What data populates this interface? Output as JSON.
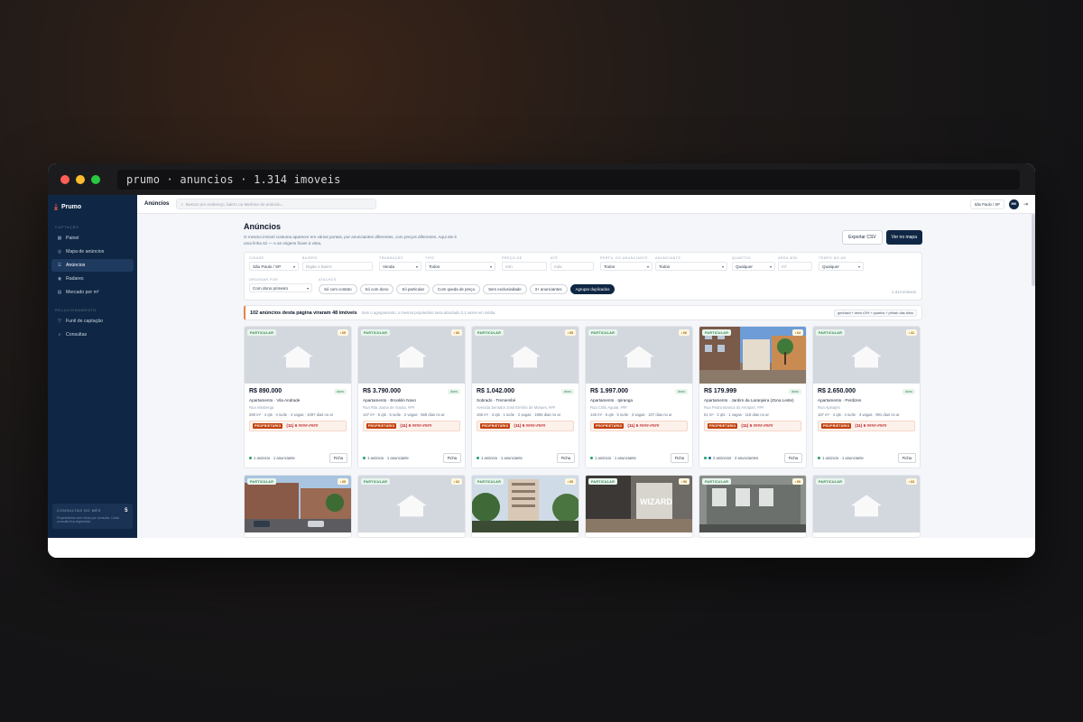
{
  "window": {
    "title": "prumo · anuncios · 1.314 imoveis"
  },
  "sidebar": {
    "brand": "Prumo",
    "sections": [
      {
        "label": "CAPTAÇÃO",
        "items": [
          {
            "label": "Painel",
            "icon": "grid-icon"
          },
          {
            "label": "Mapa de anúncios",
            "icon": "map-pin-icon"
          },
          {
            "label": "Anúncios",
            "icon": "list-icon",
            "active": true
          },
          {
            "label": "Radares",
            "icon": "radar-icon"
          },
          {
            "label": "Mercado por m²",
            "icon": "chart-icon"
          }
        ]
      },
      {
        "label": "RELACIONAMENTO",
        "items": [
          {
            "label": "Funil de captação",
            "icon": "funnel-icon"
          },
          {
            "label": "Consultas",
            "icon": "search-icon"
          }
        ]
      }
    ],
    "consultas": {
      "label": "CONSULTAS DO MÊS",
      "value": "5",
      "sub": "Proprietários com início por consulta. Cada consulta fica registrada."
    }
  },
  "topbar": {
    "title": "Anúncios",
    "search_placeholder": "Buscar por endereço, bairro ou telefone do anúncio...",
    "city": "São Paulo / SP",
    "avatar": "MK"
  },
  "page": {
    "title": "Anúncios",
    "description": "O mesmo imóvel costuma aparecer em vários portais, por anunciantes diferentes, com preços diferentes. Aqui ele é uma linha só — e as origens ficam à vista.",
    "export_label": "Exportar CSV",
    "map_label": "Ver no mapa"
  },
  "filters": {
    "cidade": {
      "label": "CIDADE",
      "value": "São Paulo / SP"
    },
    "bairro": {
      "label": "BAIRRO",
      "placeholder": "Digite o bairro"
    },
    "transacao": {
      "label": "TRANSAÇÃO",
      "value": "Venda"
    },
    "tipo": {
      "label": "TIPO",
      "value": "Todos"
    },
    "preco_de": {
      "label": "PREÇO DE",
      "placeholder": "mín"
    },
    "ate": {
      "label": "ATÉ",
      "placeholder": "máx"
    },
    "perfil": {
      "label": "PERFIL DO ANUNCIANTE",
      "value": "Todos"
    },
    "anunciante": {
      "label": "ANUNCIANTE",
      "value": "Todos"
    },
    "quartos": {
      "label": "QUARTOS",
      "value": "Qualquer"
    },
    "area": {
      "label": "ÁREA MÍN.",
      "placeholder": "m²"
    },
    "tempo": {
      "label": "TEMPO NO AR",
      "value": "Qualquer"
    },
    "ordenar": {
      "label": "ORDENAR POR",
      "value": "Com dono primeiro"
    },
    "atalhos_label": "ATALHOS",
    "chips": [
      {
        "label": "Só com contato",
        "active": false
      },
      {
        "label": "Só com dono",
        "active": false
      },
      {
        "label": "Só particular",
        "active": false
      },
      {
        "label": "Com queda de preço",
        "active": false
      },
      {
        "label": "Sem exclusividade",
        "active": false
      },
      {
        "label": "3+ anunciantes",
        "active": false
      },
      {
        "label": "Agrupar duplicados",
        "active": true
      }
    ],
    "count": "1.314 imóveis"
  },
  "banner": {
    "headline": "102 anúncios desta página viraram 48 imóveis",
    "detail": "Sem o agrupamento, o mesmo proprietário seria abordado 2,1 vezes em média.",
    "rule": "geohash + área ±3% + quartos + pHash das fotos"
  },
  "cards": [
    {
      "badge": "PARTICULAR",
      "score": "• 65",
      "price": "R$ 890.000",
      "dono": "dono",
      "type": "Apartamento · Vila Andrade",
      "addr": "Rua Ivitaberga",
      "specs": "269 m² · 4 qts · 4 suíte · 4 vagas · 1097 dias no ar",
      "owner_tag": "PROPRIETÁRIO",
      "phone": "(11) 9 ####-####",
      "ann": "1 anúncio · 1 anunciante",
      "ficha": "Ficha",
      "photo": "placeholder",
      "dots": 1
    },
    {
      "badge": "PARTICULAR",
      "score": "• 66",
      "price": "R$ 3.790.000",
      "dono": "dono",
      "type": "Apartamento · Brooklin Novo",
      "addr": "Rua Rita Joana de Sousa, ###",
      "specs": "147 m² · 5 qts · 5 suíte · 2 vagas · 568 dias no ar",
      "owner_tag": "PROPRIETÁRIO",
      "phone": "(11) 9 ####-####",
      "ann": "1 anúncio · 1 anunciante",
      "ficha": "Ficha",
      "photo": "placeholder",
      "dots": 1
    },
    {
      "badge": "PARTICULAR",
      "score": "• 65",
      "price": "R$ 1.042.000",
      "dono": "dono",
      "type": "Sobrado · Tremembé",
      "addr": "Avenida Senador José Ermírio de Moraes, ###",
      "specs": "168 m² · 3 qts · 1 suíte · 2 vagas · 1965 dias no ar",
      "owner_tag": "PROPRIETÁRIO",
      "phone": "(11) 9 ####-####",
      "ann": "1 anúncio · 1 anunciante",
      "ficha": "Ficha",
      "photo": "placeholder",
      "dots": 1
    },
    {
      "badge": "PARTICULAR",
      "score": "• 66",
      "price": "R$ 1.997.000",
      "dono": "dono",
      "type": "Apartamento · Ipiranga",
      "addr": "Rua Cirilo Aguiar, ###",
      "specs": "146 m² · 5 qts · 5 suíte · 3 vagas · 107 dias no ar",
      "owner_tag": "PROPRIETÁRIO",
      "phone": "(11) 9 ####-####",
      "ann": "1 anúncio · 1 anunciante",
      "ficha": "Ficha",
      "photo": "placeholder",
      "dots": 1
    },
    {
      "badge": "PARTICULAR",
      "score": "• 64",
      "price": "R$ 179.999",
      "dono": "dono",
      "type": "Apartamento · Jardim da Laranjeira (Zona Leste)",
      "addr": "Rua Pedra Branca do Amapari, ###",
      "specs": "51 m² · 2 qts · 1 vagas · 118 dias no ar",
      "owner_tag": "PROPRIETÁRIO",
      "phone": "(11) 9 ####-####",
      "ann": "2 anúncios · 2 anunciantes",
      "ficha": "Ficha",
      "photo": "street",
      "dots": 2
    },
    {
      "badge": "PARTICULAR",
      "score": "• 41",
      "price": "R$ 2.650.000",
      "dono": "dono",
      "type": "Apartamento · Perdizes",
      "addr": "Rua Apinajés",
      "specs": "167 m² · 4 qts · 4 suíte · 3 vagas · 991 dias no ar",
      "owner_tag": "PROPRIETÁRIO",
      "phone": "(11) 9 ####-####",
      "ann": "1 anúncio · 1 anunciante",
      "ficha": "Ficha",
      "photo": "placeholder",
      "dots": 1
    },
    {
      "badge": "PARTICULAR",
      "score": "• 65",
      "photo": "buildings",
      "short": true
    },
    {
      "badge": "PARTICULAR",
      "score": "• 62",
      "photo": "placeholder",
      "short": true
    },
    {
      "badge": "PARTICULAR",
      "score": "• 65",
      "photo": "tower",
      "short": true
    },
    {
      "badge": "PARTICULAR",
      "score": "• 50",
      "photo": "interior",
      "watermark": "WIZARD",
      "short": true
    },
    {
      "badge": "PARTICULAR",
      "score": "• 50",
      "photo": "gate",
      "short": true
    },
    {
      "badge": "PARTICULAR",
      "score": "• 63",
      "photo": "placeholder",
      "short": true
    }
  ]
}
